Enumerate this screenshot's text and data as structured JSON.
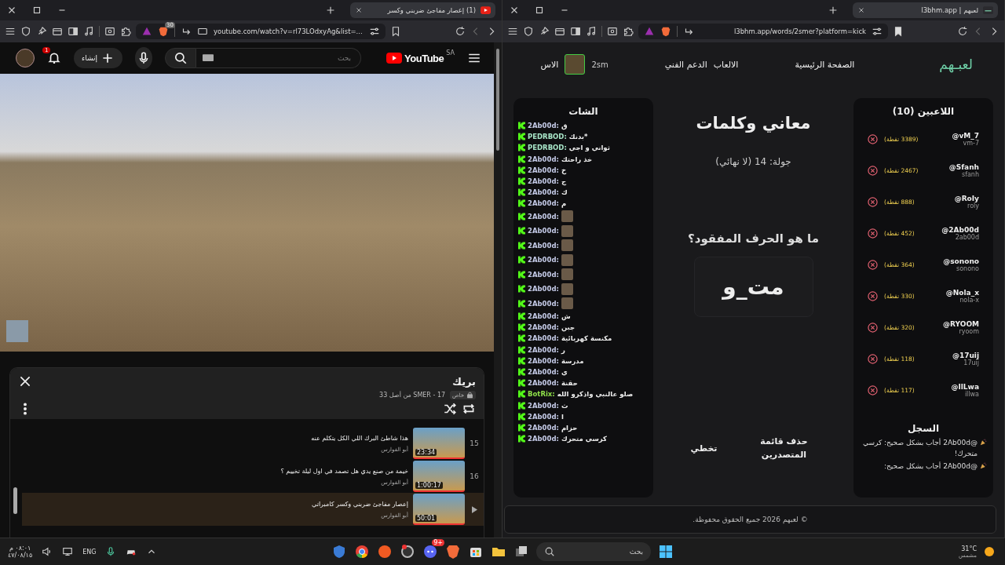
{
  "windows": [
    {
      "kind": "site",
      "tab_title": "لعبهم | l3bhm.app",
      "url": "l3bhm.app/words/2smer?platform=kick",
      "bookmarked": true
    },
    {
      "kind": "youtube",
      "tab_title": "(1) إعصار مفاجئ ضربني وكسر",
      "url": "youtube.com/watch?v=rl73LOdxyAg&list=...",
      "shield_badge": "30",
      "bookmarked": false
    }
  ],
  "youtube": {
    "logo": "YouTube",
    "region": "SA",
    "search_placeholder": "بحث",
    "create_label": "إنشاء",
    "notification_count": "1",
    "playlist": {
      "title": "بريك",
      "privacy": "خاص",
      "meta": "SMER - 17 من أصل 33",
      "items": [
        {
          "index": "15",
          "title": "هذا شاطئ البرك اللي الكل يتكلم عنه",
          "channel": "أبو الفوارس",
          "duration": "23:34",
          "selected": false
        },
        {
          "index": "16",
          "title": "خيمة من صنع يدي هل تصمد في اول ليلة تخييم ؟",
          "channel": "أبو الفوارس",
          "duration": "1:00:17",
          "selected": false
        },
        {
          "title": "إعصار مفاجئ ضربني وكسر كامبراتي",
          "channel": "أبو الفوارس",
          "duration": "50:01",
          "selected": true
        }
      ]
    }
  },
  "site": {
    "logo": "لعبـهم",
    "nav": [
      {
        "label": "الصفحة الرئيسية"
      },
      {
        "label": "الالعاب"
      },
      {
        "label": "الدعم الفني"
      }
    ],
    "username": "2sm",
    "nav_cut": "الاس",
    "chat": {
      "title": "الشات",
      "messages": [
        {
          "kind": "text",
          "user": "2Ab00d:",
          "color": "#c5cbe8",
          "text": "ق"
        },
        {
          "kind": "text",
          "user": "PEDRBOD:",
          "color": "#a8e6c8",
          "text": "*بدنك"
        },
        {
          "kind": "text",
          "user": "PEDRBOD:",
          "color": "#a8e6c8",
          "text": "ثواني و اجي"
        },
        {
          "kind": "text",
          "user": "2Ab00d:",
          "color": "#c5cbe8",
          "text": "خذ راحتك"
        },
        {
          "kind": "text",
          "user": "2Ab00d:",
          "color": "#c5cbe8",
          "text": "خ"
        },
        {
          "kind": "text",
          "user": "2Ab00d:",
          "color": "#c5cbe8",
          "text": "ج"
        },
        {
          "kind": "text",
          "user": "2Ab00d:",
          "color": "#c5cbe8",
          "text": "ك"
        },
        {
          "kind": "text",
          "user": "2Ab00d:",
          "color": "#c5cbe8",
          "text": "م"
        },
        {
          "kind": "emote",
          "user": "2Ab00d:",
          "color": "#c5cbe8"
        },
        {
          "kind": "emote",
          "user": "2Ab00d:",
          "color": "#c5cbe8"
        },
        {
          "kind": "emote",
          "user": "2Ab00d:",
          "color": "#c5cbe8"
        },
        {
          "kind": "emote",
          "user": "2Ab00d:",
          "color": "#c5cbe8"
        },
        {
          "kind": "emote",
          "user": "2Ab00d:",
          "color": "#c5cbe8"
        },
        {
          "kind": "emote",
          "user": "2Ab00d:",
          "color": "#c5cbe8"
        },
        {
          "kind": "emote",
          "user": "2Ab00d:",
          "color": "#c5cbe8"
        },
        {
          "kind": "text",
          "user": "2Ab00d:",
          "color": "#c5cbe8",
          "text": "ش"
        },
        {
          "kind": "text",
          "user": "2Ab00d:",
          "color": "#c5cbe8",
          "text": "جبن"
        },
        {
          "kind": "text",
          "user": "2Ab00d:",
          "color": "#c5cbe8",
          "text": "مكنسة كهربائية"
        },
        {
          "kind": "text",
          "user": "2Ab00d:",
          "color": "#c5cbe8",
          "text": "ر"
        },
        {
          "kind": "text",
          "user": "2Ab00d:",
          "color": "#c5cbe8",
          "text": "مدرسة"
        },
        {
          "kind": "text",
          "user": "2Ab00d:",
          "color": "#c5cbe8",
          "text": "ي"
        },
        {
          "kind": "text",
          "user": "2Ab00d:",
          "color": "#c5cbe8",
          "text": "حقنة"
        },
        {
          "kind": "text",
          "user": "BotRix:",
          "color": "#8fe04a",
          "text": "صلو عالنبي واذكرو الله"
        },
        {
          "kind": "text",
          "user": "2Ab00d:",
          "color": "#c5cbe8",
          "text": "ث"
        },
        {
          "kind": "text",
          "user": "2Ab00d:",
          "color": "#c5cbe8",
          "text": "ا"
        },
        {
          "kind": "text",
          "user": "2Ab00d:",
          "color": "#c5cbe8",
          "text": "حزام"
        },
        {
          "kind": "text",
          "user": "2Ab00d:",
          "color": "#c5cbe8",
          "text": "كرسي متحرك"
        }
      ]
    },
    "game": {
      "title": "معاني وكلمات",
      "round": "جولة: 14 (لا نهائي)",
      "question": "ما هو الحرف المفقود؟",
      "word": "مت_و",
      "actions": [
        {
          "label": "حذف قائمة المتصدرين"
        },
        {
          "label": "تخطي"
        }
      ]
    },
    "players": {
      "title": "اللاعبين (10)",
      "list": [
        {
          "handle": "@vM_7",
          "name": "vm-7",
          "points": "(3389 نقطة)"
        },
        {
          "handle": "@Sfanh",
          "name": "sfanh",
          "points": "(2467 نقطة)"
        },
        {
          "handle": "@RoIy",
          "name": "roly",
          "points": "(888 نقطة)"
        },
        {
          "handle": "@2Ab00d",
          "name": "2ab00d",
          "points": "(452 نقطة)"
        },
        {
          "handle": "@sonono",
          "name": "sonono",
          "points": "(364 نقطة)"
        },
        {
          "handle": "@Nola_x",
          "name": "nola-x",
          "points": "(330 نقطة)"
        },
        {
          "handle": "@RYOOM",
          "name": "ryoom",
          "points": "(320 نقطة)"
        },
        {
          "handle": "@17uij",
          "name": "17uij",
          "points": "(118 نقطة)"
        },
        {
          "handle": "@IlLwa",
          "name": "illwa",
          "points": "(117 نقطة)"
        }
      ]
    },
    "log": {
      "title": "السجل",
      "entries": [
        {
          "text": "@2Ab00d أجاب بشكل صحيح: كرسي متحرك!"
        },
        {
          "text": "@2Ab00d أجاب بشكل صحيح:"
        }
      ]
    },
    "footer": "© لعبهم 2026 جميع الحقوق محفوظة."
  },
  "taskbar": {
    "time": "٠٨:٠١ م",
    "date": "٤٧/٠٨/١٥",
    "language": "ENG",
    "app_badge": "9+",
    "search_placeholder": "بحث",
    "temperature": "31°C",
    "condition": "مشمس"
  }
}
